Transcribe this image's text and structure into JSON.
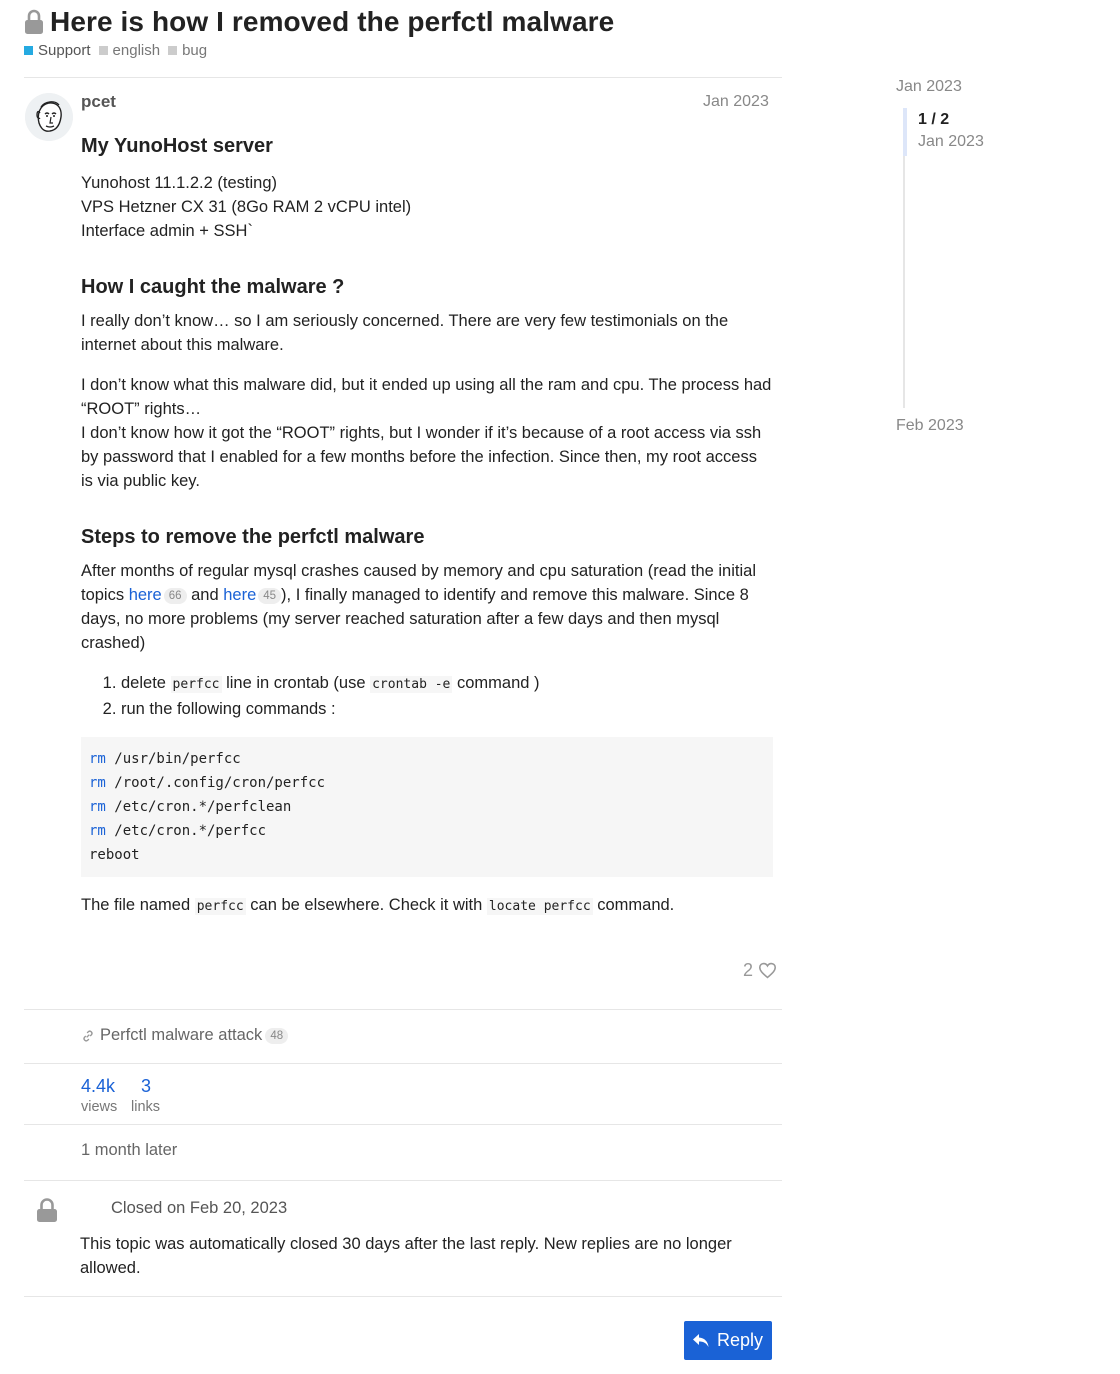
{
  "topic": {
    "title": "Here is how I removed the perfctl malware",
    "categories": [
      {
        "label": "Support",
        "color": "#25aae1"
      },
      {
        "label": "english",
        "color": "#cccccc"
      },
      {
        "label": "bug",
        "color": "#cccccc"
      }
    ]
  },
  "post": {
    "username": "pcet",
    "date": "Jan 2023",
    "h_server": "My YunoHost server",
    "server_lines": [
      "Yunohost 11.1.2.2 (testing)",
      "VPS Hetzner CX 31 (8Go RAM 2 vCPU intel)",
      "Interface admin + SSH`"
    ],
    "h_caught": "How I caught the malware ?",
    "p_caught": "I really don’t know… so I am seriously concerned. There are very few testimonials on the internet about this malware.",
    "p_did_1": "I don’t know what this malware did, but it ended up using all the ram and cpu. The process had “ROOT” rights…",
    "p_did_2": "I don’t know how it got the “ROOT” rights, but I wonder if it’s because of a root access via ssh by password that I enabled for a few months before the infection. Since then, my root access is via public key.",
    "h_steps": "Steps to remove the perfctl malware",
    "steps_intro": {
      "t1": "After months of regular mysql crashes caused by memory and cpu saturation (read the initial topics ",
      "link1": "here",
      "badge1": "66",
      "t2": " and ",
      "link2": "here",
      "badge2": "45",
      "t3": "), I finally managed to identify and remove this malware. Since 8 days, no more problems (my server reached saturation after a few days and then mysql crashed)"
    },
    "list": {
      "i1_a": "delete ",
      "i1_code": "perfcc",
      "i1_b": " line in crontab (use ",
      "i1_code2": "crontab -e",
      "i1_c": " command )",
      "i2": "run the following commands :"
    },
    "code": [
      {
        "kw": "rm",
        "arg": " /usr/bin/perfcc"
      },
      {
        "kw": "rm",
        "arg": " /root/.config/cron/perfcc"
      },
      {
        "kw": "rm",
        "arg": " /etc/cron.*/perfclean"
      },
      {
        "kw": "rm",
        "arg": " /etc/cron.*/perfcc"
      },
      {
        "kw": "",
        "arg": "reboot"
      }
    ],
    "final": {
      "a": "The file named ",
      "code1": "perfcc",
      "b": " can be elsewhere. Check it with ",
      "code2": "locate perfcc",
      "c": " command."
    },
    "likes": "2"
  },
  "linked": {
    "label": "Perfctl malware attack",
    "count": "48"
  },
  "stats": {
    "views_num": "4.4k",
    "views_lbl": "views",
    "links_num": "3",
    "links_lbl": "links"
  },
  "gap": "1 month later",
  "closed": {
    "title": "Closed on Feb 20, 2023",
    "text": "This topic was automatically closed 30 days after the last reply. New replies are no longer allowed."
  },
  "reply_label": "Reply",
  "timeline": {
    "start": "Jan 2023",
    "position": "1 / 2",
    "position_date": "Jan 2023",
    "end": "Feb 2023"
  }
}
